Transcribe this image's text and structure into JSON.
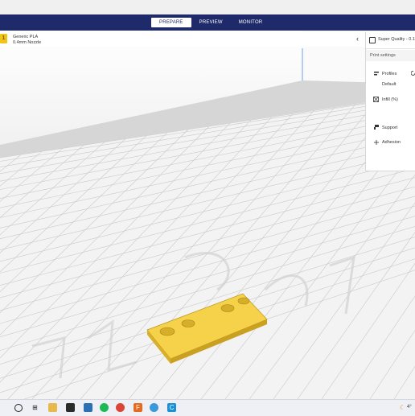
{
  "header": {
    "tabs": [
      {
        "label": "PREPARE",
        "active": true
      },
      {
        "label": "PREVIEW",
        "active": false
      },
      {
        "label": "MONITOR",
        "active": false
      }
    ],
    "color": "#1f2a6b"
  },
  "material": {
    "name": "Generic PLA",
    "nozzle": "0.4mm Nozzle",
    "color": "#f3c418"
  },
  "print_panel": {
    "quality": "Super Quality - 0.1",
    "section_title": "Print settings",
    "profiles_label": "Profiles",
    "profile_value": "Default",
    "infill_label": "Infill (%)",
    "support_label": "Support",
    "adhesion_label": "Adhesion"
  },
  "model": {
    "color": "#f5d24a"
  },
  "taskbar": {
    "icons": [
      "search-circle-icon",
      "task-view-icon",
      "file-explorer-icon",
      "store-icon",
      "mail-icon",
      "spotify-icon",
      "chrome-icon",
      "skype-icon",
      "foxit-icon",
      "app-blue-icon",
      "cura-icon"
    ],
    "weather": "4°"
  }
}
